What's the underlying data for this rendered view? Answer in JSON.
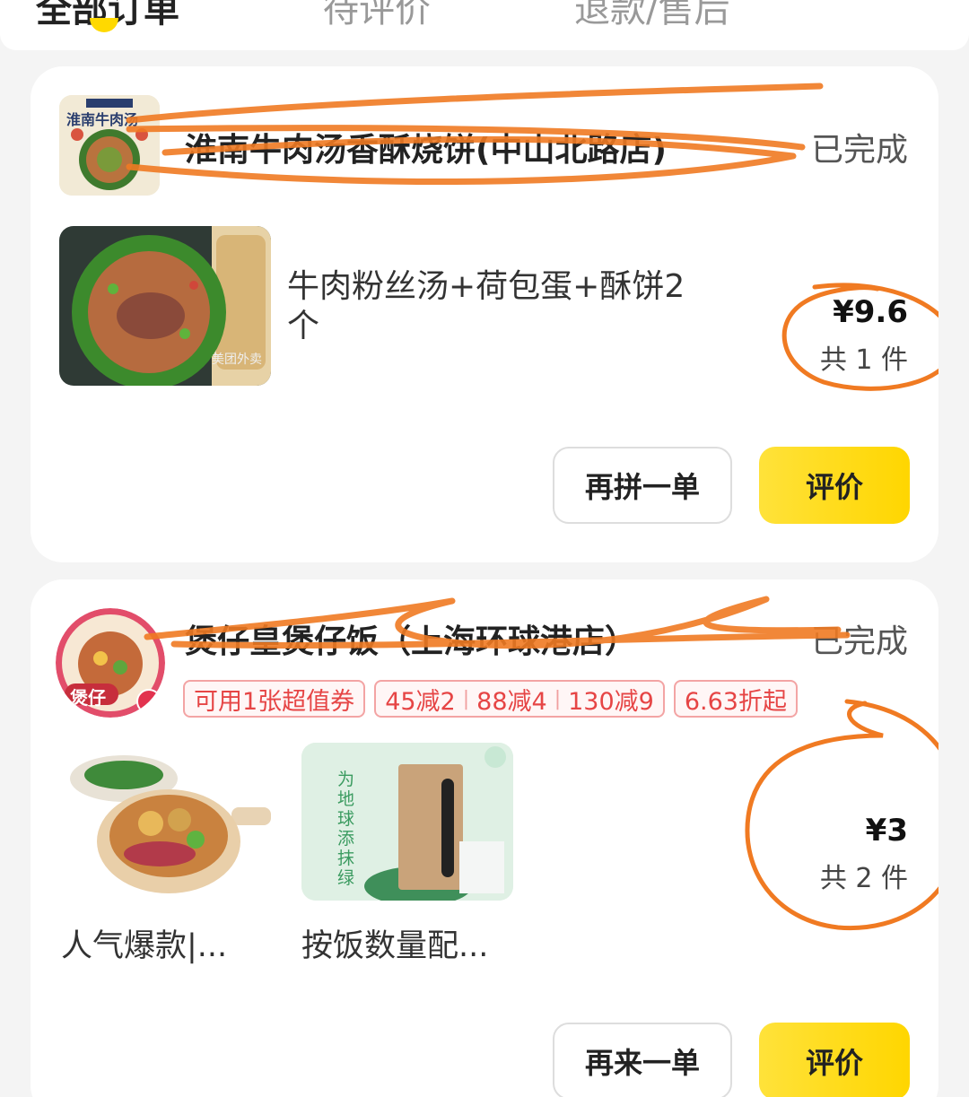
{
  "tabs": [
    {
      "label": "全部订单"
    },
    {
      "label": "待评价"
    },
    {
      "label": "退款/售后"
    }
  ],
  "colors": {
    "accent": "#ffd900",
    "promo": "#e64545",
    "scribble": "#f07a22"
  },
  "orders": [
    {
      "store_name": "淮南牛肉汤香酥烧饼(中山北路店)",
      "logo_text": "淮南牛肉汤",
      "status": "已完成",
      "item_desc": "牛肉粉丝汤+荷包蛋+酥饼2个",
      "watermark": "美团外卖",
      "price": "¥9.6",
      "qty": "共 1 件",
      "buttons": {
        "reorder": "再拼一单",
        "review": "评价"
      }
    },
    {
      "store_name": "煲仔皇煲仔饭（上海环球港店）",
      "logo_text": "煲仔",
      "status": "已完成",
      "promos": {
        "coupon": "可用1张超值券",
        "discounts": [
          "45减2",
          "88减4",
          "130减9"
        ],
        "rate": "6.63折起"
      },
      "items": [
        {
          "caption": "人气爆款|..."
        },
        {
          "caption": "按饭数量配...",
          "thumb_text": "为地球添抹绿"
        }
      ],
      "price": "¥3",
      "qty": "共 2 件",
      "buttons": {
        "reorder": "再来一单",
        "review": "评价"
      }
    }
  ]
}
